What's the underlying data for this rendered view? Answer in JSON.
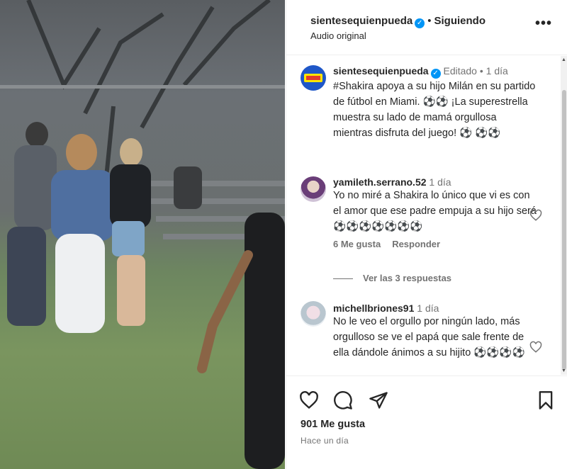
{
  "header": {
    "username": "sientesequienpueda",
    "verified_mark": "✓",
    "separator": "•",
    "follow_status": "Siguiendo",
    "audio": "Audio original",
    "more": "•••"
  },
  "caption": {
    "username": "sientesequienpueda",
    "edited": "Editado",
    "separator": "•",
    "age": "1 día",
    "text": "#Shakira apoya a su hijo Milán en su partido de fútbol en Miami. ⚽⚽ ¡La superestrella muestra su lado de mamá orgullosa mientras disfruta del juego! ⚽ ⚽⚽"
  },
  "comments": [
    {
      "username": "yamileth.serrano.52",
      "age": "1 día",
      "text": "Yo no miré a Shakira lo único que vi es con el amor que ese padre empuja a su hijo será ⚽⚽⚽⚽⚽⚽⚽",
      "likes": "6 Me gusta",
      "reply": "Responder"
    },
    {
      "username": "michellbriones91",
      "age": "1 día",
      "text": "No le veo el orgullo por ningún lado, más orgulloso se ve el papá que sale frente de ella dándole ánimos a su hijito ⚽⚽⚽⚽"
    }
  ],
  "view_replies": "Ver las 3 respuestas",
  "footer": {
    "likes": "901 Me gusta",
    "time": "Hace un día"
  },
  "icons": {
    "like": "heart-icon",
    "comment": "comment-icon",
    "share": "share-icon",
    "save": "bookmark-icon"
  },
  "colors": {
    "verified": "#0095f6",
    "secondary_text": "#737373",
    "primary_text": "#262626"
  }
}
